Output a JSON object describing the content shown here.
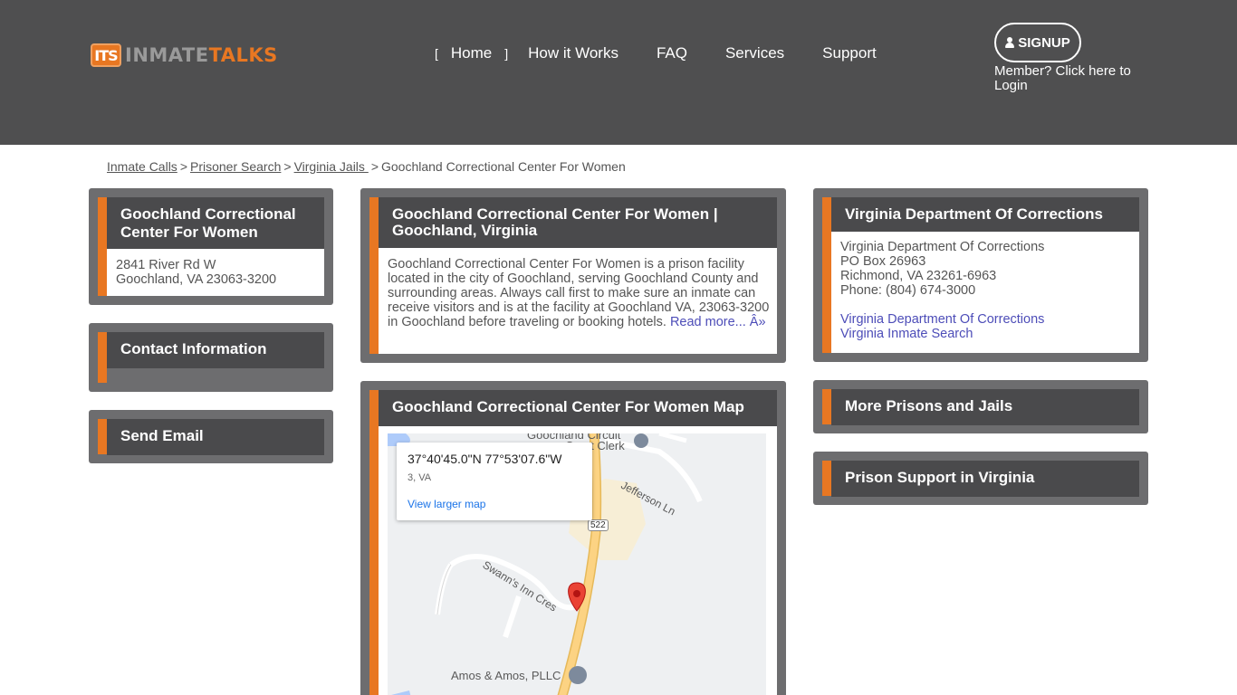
{
  "header": {
    "logo_mark": "ITS",
    "logo_word_a": "INMATE",
    "logo_word_b": "TALKS",
    "nav": [
      {
        "label": "Home",
        "active": true
      },
      {
        "label": "How it Works"
      },
      {
        "label": "FAQ"
      },
      {
        "label": "Services"
      },
      {
        "label": "Support"
      }
    ],
    "bracket_left": "[",
    "bracket_right": "]",
    "signup_label": "SIGNUP",
    "login_text": "Member? Click here to Login"
  },
  "breadcrumb": {
    "items": [
      "Inmate Calls",
      "Prisoner Search",
      "Virginia Jails "
    ],
    "separator": ">",
    "current": "Goochland Correctional Center For Women"
  },
  "left": {
    "facility": {
      "icon": "",
      "title": "Goochland Correctional Center For Women",
      "address_line1": "2841 River Rd W",
      "address_line2": "Goochland, VA 23063-3200"
    },
    "contact": {
      "title": "Contact Information ",
      "icon": ""
    },
    "email": {
      "title": "Send Email ",
      "icon": ""
    }
  },
  "center": {
    "about": {
      "title": "Goochland Correctional Center For Women | Goochland, Virginia",
      "body": "Goochland Correctional Center For Women is a prison facility located in the city of Goochland, serving Goochland County and surrounding areas. Always call first to make sure an inmate can receive visitors and is at the facility at Goochland VA, 23063-3200 in Goochland before traveling or booking hotels. ",
      "read_more": "Read more... Â»"
    },
    "map": {
      "icon": "",
      "title": " Goochland Correctional Center For Women Map",
      "popup_coords": "37°40'45.0\"N 77°53'07.6\"W",
      "popup_sub": "3, VA",
      "popup_link": "View larger map",
      "labels": {
        "court": "Goochland Circuit",
        "court2": "Court Clerk",
        "jefferson": "Jefferson Ln",
        "swann": "Swann's Inn Cres",
        "amos": "Amos & Amos, PLLC",
        "shield": "522"
      }
    }
  },
  "right": {
    "doc": {
      "title": "Virginia Department Of Corrections",
      "line1": "Virginia Department Of Corrections",
      "line2": "PO Box 26963",
      "line3": "Richmond, VA 23261-6963",
      "line4": "Phone: (804) 674-3000",
      "link1": "Virginia Department Of Corrections",
      "link2": "Virginia Inmate Search"
    },
    "more": {
      "icon": "",
      "title": "More Prisons and Jails"
    },
    "support": {
      "icon": "",
      "title": "Prison Support in Virginia"
    }
  },
  "colors": {
    "accent": "#e87722",
    "header_bg": "#4f4f50",
    "panel_frame": "#6d6d6f",
    "panel_head": "#4a4a4c",
    "link": "#4d4db8"
  }
}
